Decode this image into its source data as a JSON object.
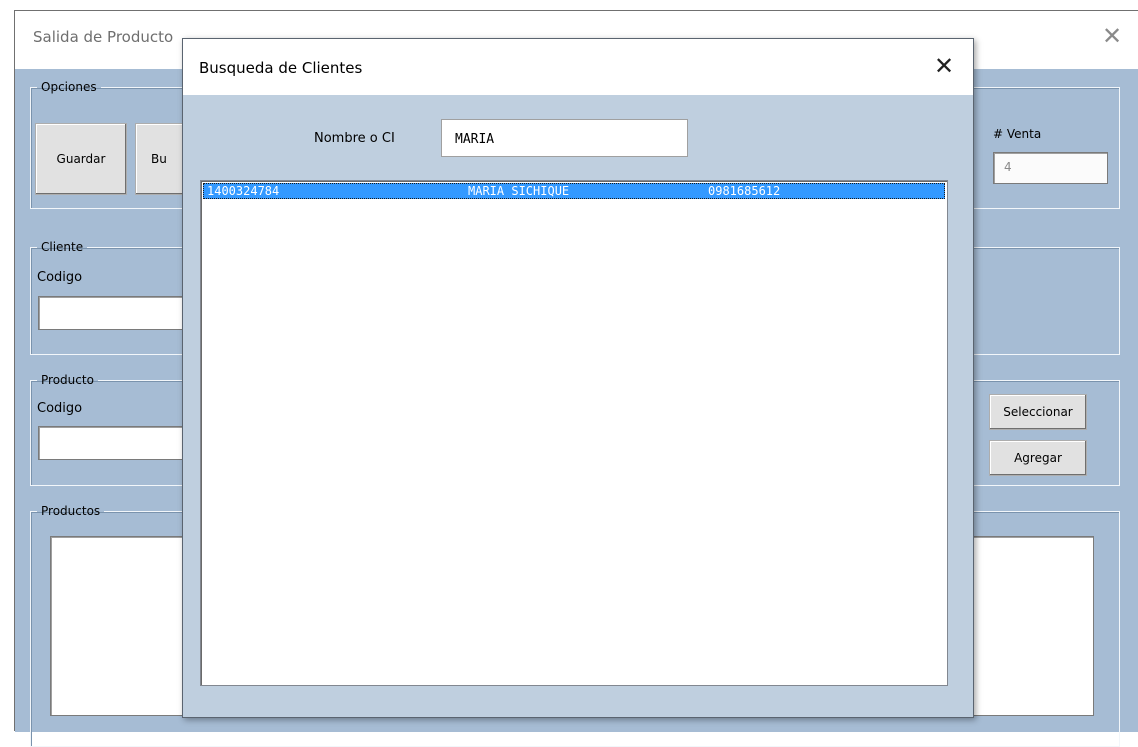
{
  "main_window": {
    "title": "Salida de Producto",
    "close_glyph": "✕",
    "opciones": {
      "legend": "Opciones",
      "guardar_label": "Guardar",
      "buscar_label_partial": "Bu"
    },
    "venta": {
      "label": "# Venta",
      "value": "4"
    },
    "cliente": {
      "legend": "Cliente",
      "codigo_label": "Codigo"
    },
    "producto": {
      "legend": "Producto",
      "codigo_label": "Codigo",
      "seleccionar_label": "Seleccionar",
      "agregar_label": "Agregar"
    },
    "productos": {
      "legend": "Productos"
    }
  },
  "dialog": {
    "title": "Busqueda de Clientes",
    "close_glyph": "✕",
    "search_label": "Nombre o CI",
    "search_value": "MARIA",
    "results": [
      {
        "ci": "1400324784",
        "nombre": "MARIA SICHIQUE",
        "telefono": "0981685612",
        "selected": true
      }
    ]
  },
  "colors": {
    "window_bg": "#a6bcd4",
    "dialog_bg": "#bfcfdf",
    "selection": "#3399ff"
  }
}
